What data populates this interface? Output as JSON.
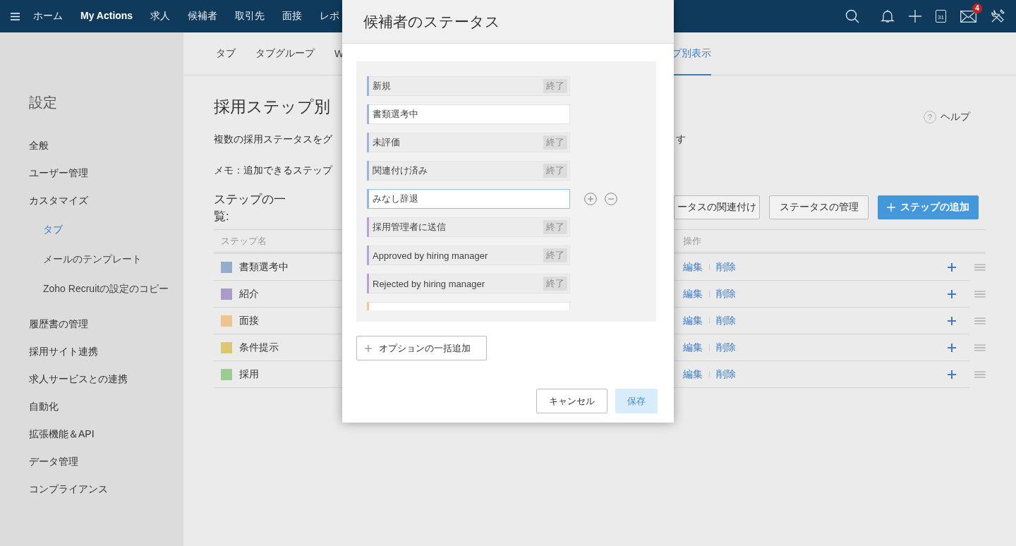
{
  "topnav": {
    "items": [
      {
        "label": "ホーム",
        "selected": false
      },
      {
        "label": "My Actions",
        "selected": true
      },
      {
        "label": "求人",
        "selected": false
      },
      {
        "label": "候補者",
        "selected": false
      },
      {
        "label": "取引先",
        "selected": false
      },
      {
        "label": "面接",
        "selected": false
      },
      {
        "label": "レポ",
        "selected": false
      }
    ],
    "calendar_day": "31",
    "mail_badge": "4"
  },
  "sidebar": {
    "title": "設定",
    "items": [
      {
        "label": "全般",
        "selected": false
      },
      {
        "label": "ユーザー管理",
        "selected": false
      },
      {
        "label": "カスタマイズ",
        "selected": false,
        "children": [
          {
            "label": "タブ",
            "selected": true
          },
          {
            "label": "メールのテンプレート",
            "selected": false
          },
          {
            "label": "Zoho Recruitの設定のコピー",
            "selected": false
          }
        ]
      },
      {
        "label": "履歴書の管理",
        "selected": false
      },
      {
        "label": "採用サイト連携",
        "selected": false
      },
      {
        "label": "求人サービスとの連携",
        "selected": false
      },
      {
        "label": "自動化",
        "selected": false
      },
      {
        "label": "拡張機能＆API",
        "selected": false
      },
      {
        "label": "データ管理",
        "selected": false
      },
      {
        "label": "コンプライアンス",
        "selected": false
      }
    ]
  },
  "main": {
    "tabs": [
      {
        "label": "タブ",
        "selected": false
      },
      {
        "label": "タブグループ",
        "selected": false
      },
      {
        "label": "W",
        "selected": false
      },
      {
        "label": "プ別表示",
        "selected": true
      }
    ],
    "title": "採用ステップ別",
    "help_icon": "?",
    "help": "ヘルプ",
    "description_parts": [
      "複数の採用ステータスをグ",
      "す"
    ],
    "memo": "メモ：追加できるステップ",
    "list_title": "ステップの一覧:",
    "buttons": [
      {
        "label": "ータスの関連付け",
        "kind": "plain"
      },
      {
        "label": "ステータスの管理",
        "kind": "plain"
      },
      {
        "label": "ステップの追加",
        "kind": "primary"
      }
    ],
    "table": {
      "columns": [
        "ステップ名",
        "操作"
      ],
      "rows": [
        {
          "name": "書類選考中",
          "color": "#93aecb",
          "actions": [
            "編集",
            "削除"
          ]
        },
        {
          "name": "紹介",
          "color": "#ab9bc9",
          "actions": [
            "編集",
            "削除"
          ]
        },
        {
          "name": "面接",
          "color": "#ecc591",
          "actions": [
            "編集",
            "削除"
          ]
        },
        {
          "name": "条件提示",
          "color": "#dcc873",
          "actions": [
            "編集",
            "削除"
          ]
        },
        {
          "name": "採用",
          "color": "#9dcc92",
          "actions": [
            "編集",
            "削除"
          ]
        }
      ]
    }
  },
  "modal": {
    "title": "候補者のステータス",
    "statuses": [
      {
        "label": "新規",
        "kind": "closed",
        "badge": "終了",
        "color": "#9bb5db"
      },
      {
        "label": "書類選考中",
        "kind": "open",
        "color": "#9bb5db"
      },
      {
        "label": "未評価",
        "kind": "closed",
        "badge": "終了",
        "color": "#9bb5db"
      },
      {
        "label": "関連付け済み",
        "kind": "closed",
        "badge": "終了",
        "color": "#9bb5db"
      },
      {
        "label": "みなし辞退",
        "kind": "editing",
        "color": "#9bb5db"
      },
      {
        "label": "採用管理者に送信",
        "kind": "closed",
        "badge": "終了",
        "color": "#b9a3d6"
      },
      {
        "label": "Approved by hiring manager",
        "kind": "closed",
        "badge": "終了",
        "color": "#b9a3d6"
      },
      {
        "label": "Rejected by hiring manager",
        "kind": "closed",
        "badge": "終了",
        "color": "#b9a3d6"
      },
      {
        "kind": "open",
        "color": "#f5c98a"
      }
    ],
    "bulk_add": "オプションの一括追加",
    "cancel": "キャンセル",
    "save": {
      "label": "保存",
      "disabled": true
    }
  }
}
